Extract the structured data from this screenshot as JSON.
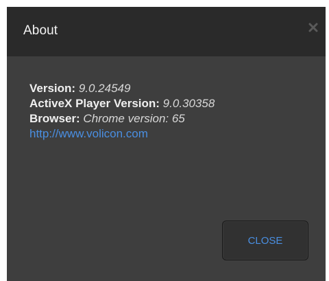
{
  "dialog": {
    "title": "About",
    "close_icon": "close-x-icon",
    "info": {
      "version_label": "Version:",
      "version_value": "9.0.24549",
      "activex_label": "ActiveX Player Version:",
      "activex_value": "9.0.30358",
      "browser_label": "Browser:",
      "browser_value": "Chrome version: 65",
      "link": "http://www.volicon.com"
    },
    "close_button_label": "CLOSE"
  },
  "colors": {
    "titlebar_bg": "#2a2a2a",
    "body_bg": "#3e3e3e",
    "accent": "#4a8fe2"
  }
}
